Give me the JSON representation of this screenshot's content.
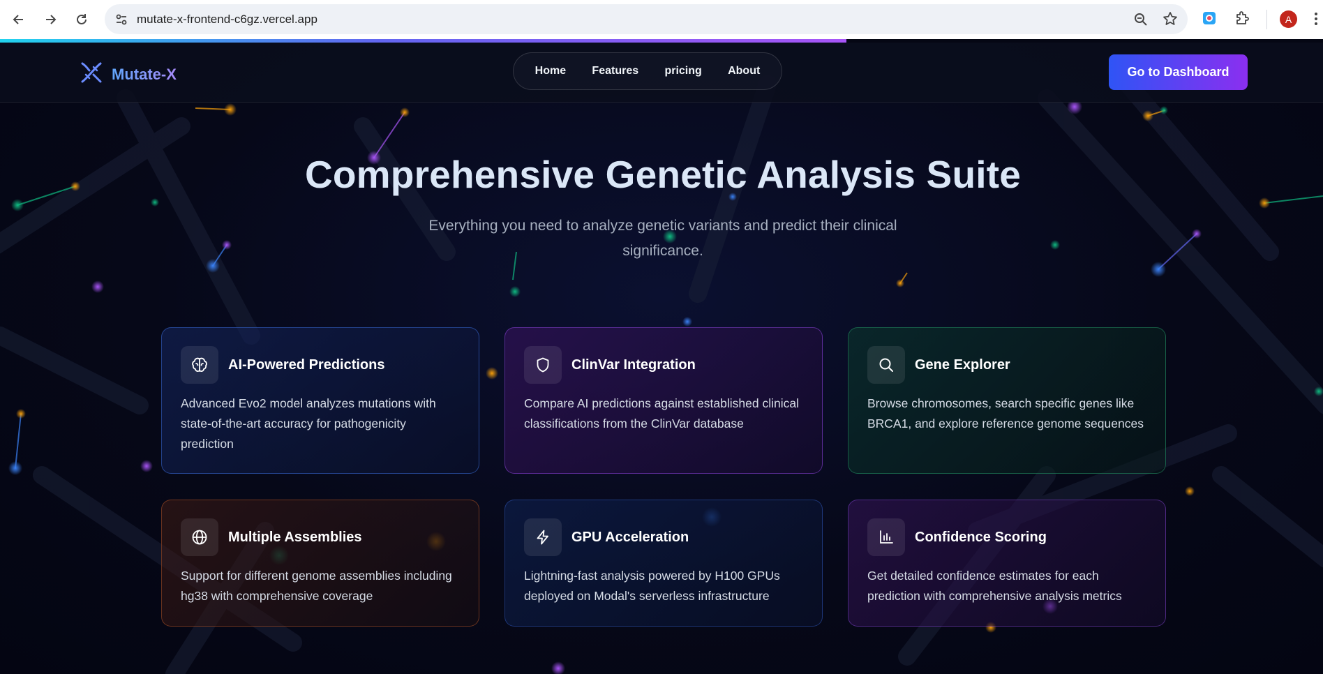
{
  "browser": {
    "url": "mutate-x-frontend-c6gz.vercel.app",
    "profile_initial": "A",
    "progress_fraction": 0.64,
    "icons": [
      "back-icon",
      "forward-icon",
      "reload-icon",
      "site-info-icon",
      "zoom-icon",
      "bookmark-star-icon",
      "extension-icon",
      "puzzle-icon",
      "menu-icon"
    ]
  },
  "navbar": {
    "brand": "Mutate-X",
    "links": [
      "Home",
      "Features",
      "pricing",
      "About"
    ],
    "cta": "Go to Dashboard"
  },
  "hero": {
    "title": "Comprehensive Genetic Analysis Suite",
    "subtitle": "Everything you need to analyze genetic variants and predict their clinical significance."
  },
  "features": [
    {
      "icon": "brain-icon",
      "title": "AI-Powered Predictions",
      "desc": "Advanced Evo2 model analyzes mutations with state-of-the-art accuracy for pathogenicity prediction"
    },
    {
      "icon": "shield-icon",
      "title": "ClinVar Integration",
      "desc": "Compare AI predictions against established clinical classifications from the ClinVar database"
    },
    {
      "icon": "search-icon",
      "title": "Gene Explorer",
      "desc": "Browse chromosomes, search specific genes like BRCA1, and explore reference genome sequences"
    },
    {
      "icon": "globe-icon",
      "title": "Multiple Assemblies",
      "desc": "Support for different genome assemblies including hg38 with comprehensive coverage"
    },
    {
      "icon": "lightning-icon",
      "title": "GPU Acceleration",
      "desc": "Lightning-fast analysis powered by H100 GPUs deployed on Modal's serverless infrastructure"
    },
    {
      "icon": "bar-chart-icon",
      "title": "Confidence Scoring",
      "desc": "Get detailed confidence estimates for each prediction with comprehensive analysis metrics"
    }
  ],
  "colors": {
    "cta_start": "#2f54f5",
    "cta_end": "#8b2ff0",
    "brand_start": "#60a5fa",
    "brand_end": "#a78bfa",
    "background": "#060818"
  }
}
